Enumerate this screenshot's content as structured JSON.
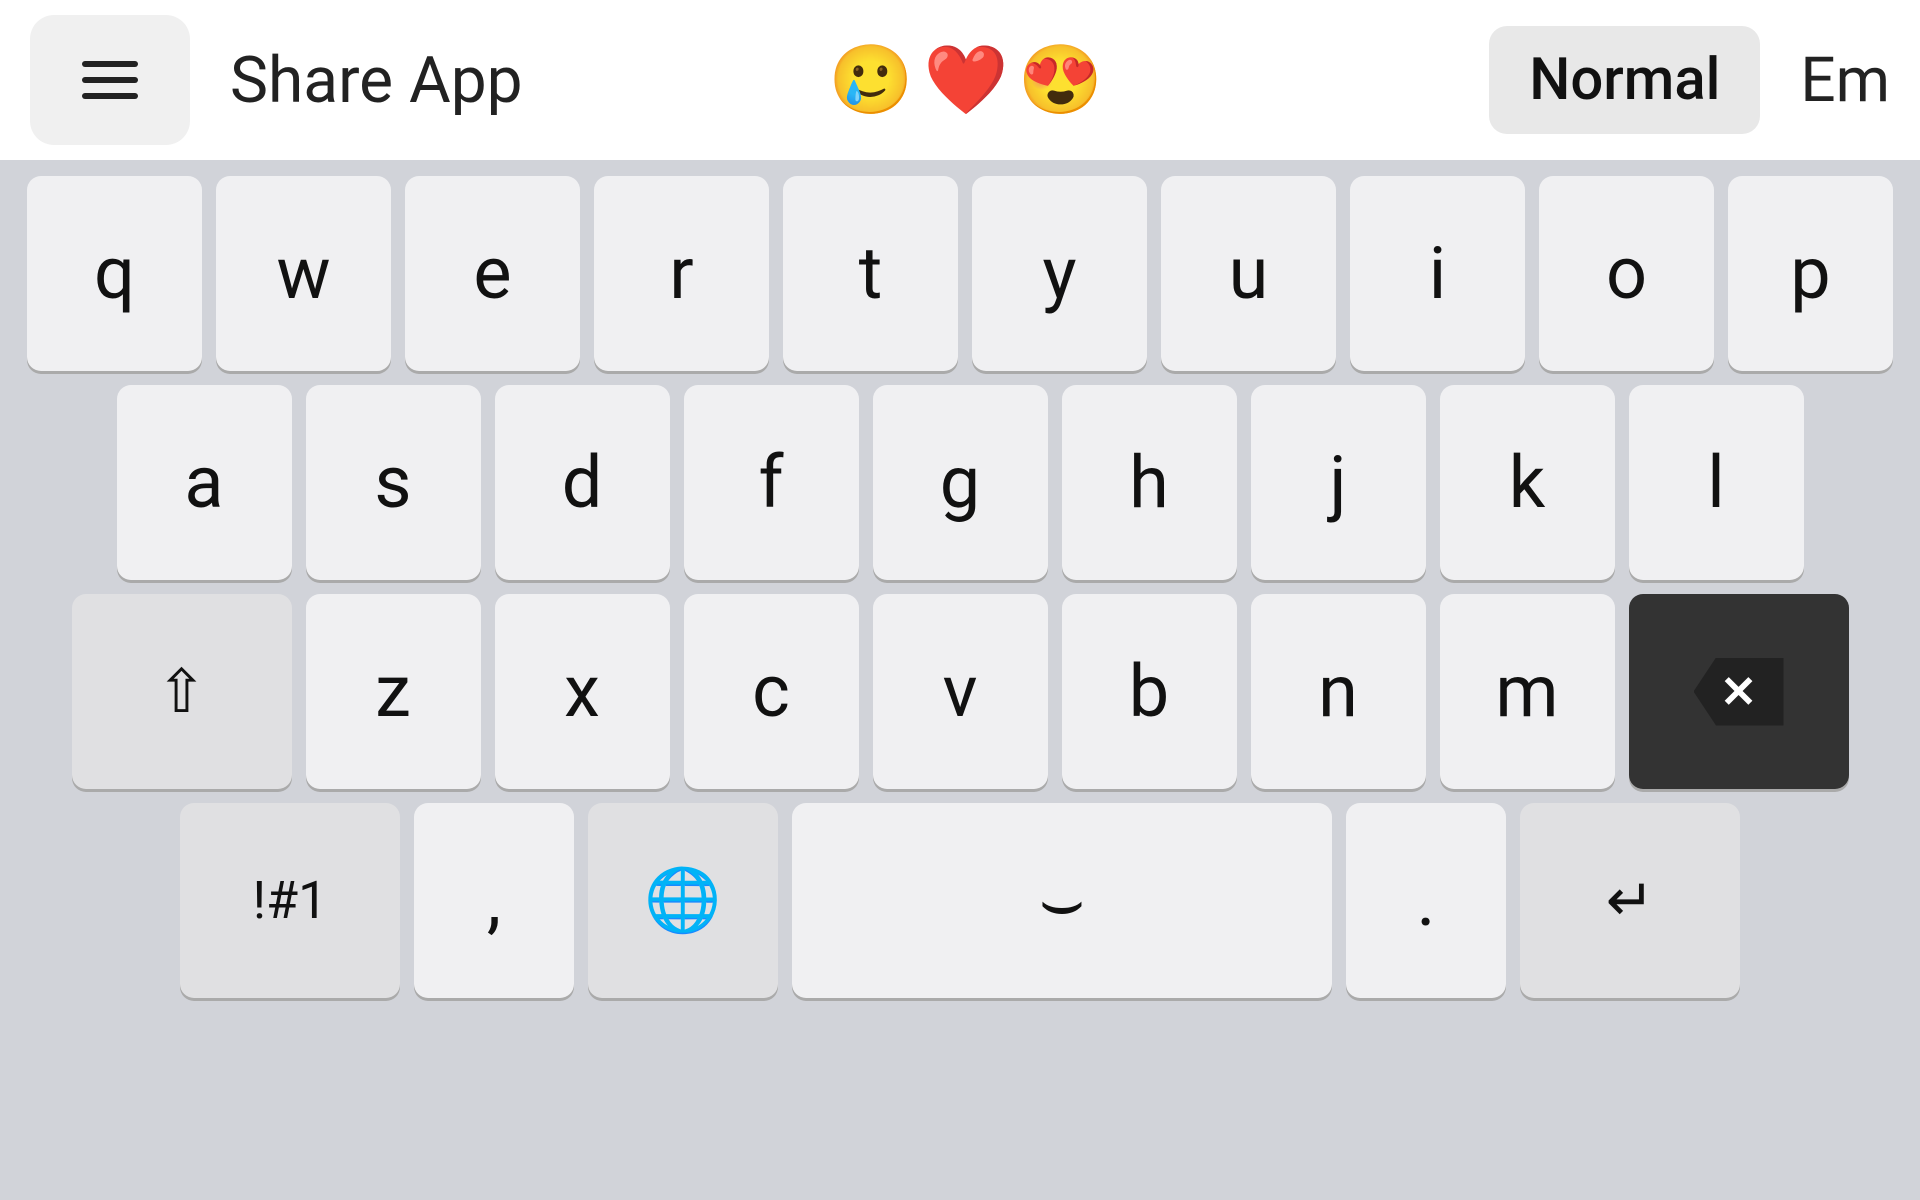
{
  "topbar": {
    "menu_label": "menu",
    "share_app": "Share App",
    "emojis": [
      "🥲",
      "❤️",
      "😍"
    ],
    "normal_label": "Normal",
    "em_label": "Em"
  },
  "keyboard": {
    "row1": [
      "q",
      "w",
      "e",
      "r",
      "t",
      "y",
      "u",
      "i",
      "o",
      "p"
    ],
    "row2": [
      "a",
      "s",
      "d",
      "f",
      "g",
      "h",
      "j",
      "k",
      "l"
    ],
    "row3_mid": [
      "z",
      "x",
      "c",
      "v",
      "b",
      "n",
      "m"
    ],
    "row4": {
      "symbol": "!#1",
      "comma": ",",
      "globe": "🌐",
      "space": "",
      "period": ".",
      "return": "↵"
    },
    "shift_symbol": "⇧",
    "backspace_symbol": "⌫"
  }
}
